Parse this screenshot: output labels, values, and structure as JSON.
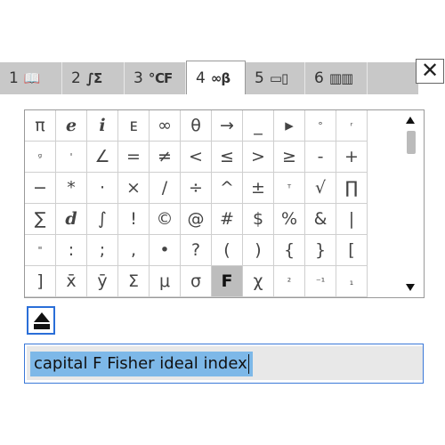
{
  "tabs": [
    {
      "num": "1",
      "icon": "📖",
      "icon_name": "book-icon"
    },
    {
      "num": "2",
      "icon": "∫Σ",
      "icon_name": "math-icon"
    },
    {
      "num": "3",
      "icon": "℃F",
      "icon_name": "units-icon"
    },
    {
      "num": "4",
      "icon": "∞β",
      "icon_name": "symbols-icon",
      "active": true
    },
    {
      "num": "5",
      "icon": "▭▯",
      "icon_name": "templates-icon"
    },
    {
      "num": "6",
      "icon": "▥▥",
      "icon_name": "library-icon"
    }
  ],
  "close_label": "✕",
  "symbols": [
    [
      "π",
      "e",
      "i",
      "ᴇ",
      "∞",
      "θ",
      "→",
      "_",
      "▸",
      "°",
      "ʳ"
    ],
    [
      "ᵍ",
      "'",
      "∠",
      "=",
      "≠",
      "<",
      "≤",
      ">",
      "≥",
      "-",
      "+"
    ],
    [
      "−",
      "*",
      "·",
      "×",
      "/",
      "÷",
      "^",
      "±",
      "ᵀ",
      "√",
      "∏"
    ],
    [
      "∑",
      "d",
      "∫",
      "!",
      "©",
      "@",
      "#",
      "$",
      "%",
      "&",
      "|"
    ],
    [
      "\"",
      ":",
      ";",
      ",",
      "•",
      "?",
      "(",
      ")",
      "{",
      "}",
      "["
    ],
    [
      "]",
      "x̄",
      "ȳ",
      "Σ",
      "μ",
      "σ",
      "F",
      "χ",
      "²",
      "⁻¹",
      "₁"
    ]
  ],
  "selected": {
    "row": 5,
    "col": 6
  },
  "description": "capital F Fisher ideal index"
}
